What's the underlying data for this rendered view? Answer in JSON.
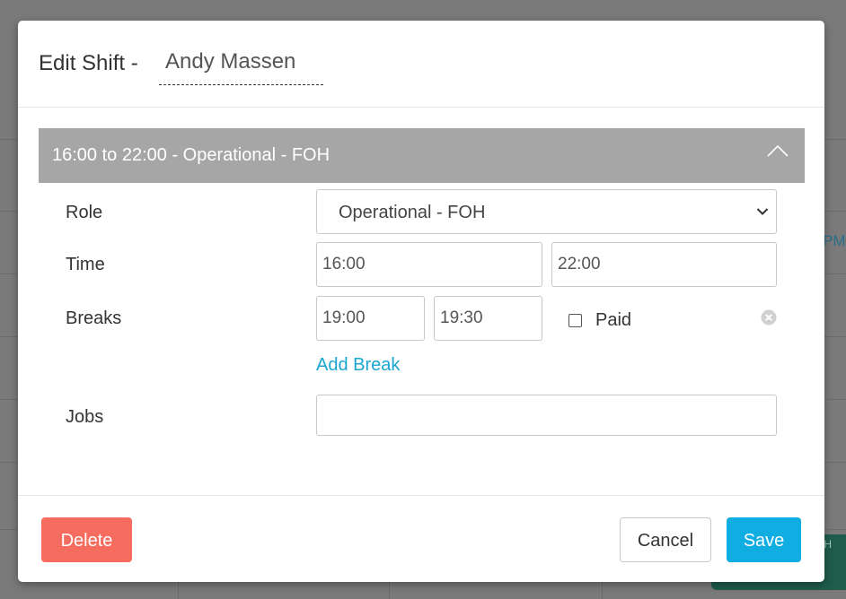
{
  "modal": {
    "title": "Edit Shift -",
    "employee_name": "Andy Massen",
    "shift_summary": "16:00 to 22:00 - Operational - FOH"
  },
  "form": {
    "role": {
      "label": "Role",
      "selected": "Operational - FOH"
    },
    "time": {
      "label": "Time",
      "start": "16:00",
      "end": "22:00"
    },
    "breaks": {
      "label": "Breaks",
      "items": [
        {
          "start": "19:00",
          "end": "19:30",
          "paid_label": "Paid",
          "paid": false
        }
      ],
      "add_label": "Add Break"
    },
    "jobs": {
      "label": "Jobs",
      "value": ""
    }
  },
  "footer": {
    "delete_label": "Delete",
    "cancel_label": "Cancel",
    "save_label": "Save"
  },
  "background": {
    "partial_text": "PM",
    "partial_badge": "H"
  },
  "colors": {
    "delete": "#f66c5e",
    "save": "#10ade2",
    "link": "#1aa6cf",
    "panel_header": "#a6a6a6"
  },
  "icons": {
    "collapse": "chevron-up-icon",
    "select": "chevron-down-icon",
    "remove": "close-circle-icon"
  }
}
